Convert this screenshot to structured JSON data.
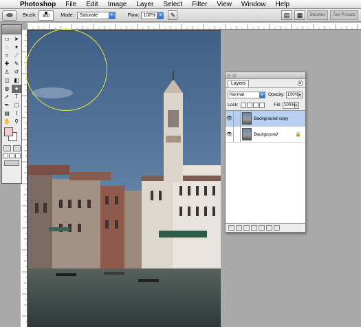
{
  "menubar": {
    "apple": "",
    "items": [
      "Photoshop",
      "File",
      "Edit",
      "Image",
      "Layer",
      "Select",
      "Filter",
      "View",
      "Window",
      "Help"
    ]
  },
  "options": {
    "brush_label": "Brush:",
    "brush_size": "800",
    "mode_label": "Mode:",
    "mode_value": "Saturate",
    "flow_label": "Flow:",
    "flow_value": "100%",
    "palette_tabs": [
      "Brushes",
      "Tool Presets"
    ]
  },
  "layers_panel": {
    "tab": "Layers",
    "blend_mode": "Normal",
    "opacity_label": "Opacity:",
    "opacity_value": "100%",
    "lock_label": "Lock:",
    "fill_label": "Fill:",
    "fill_value": "100%",
    "layers": [
      {
        "name": "Background copy",
        "visible": true,
        "active": true
      },
      {
        "name": "Background",
        "visible": true,
        "active": false,
        "locked": true
      }
    ]
  },
  "toolbox": {
    "foreground_color": "#f4c9d0",
    "background_color": "#ffffff"
  },
  "icons": {
    "apple": "apple-icon",
    "eye": "eye-icon",
    "lock": "lock-icon"
  }
}
